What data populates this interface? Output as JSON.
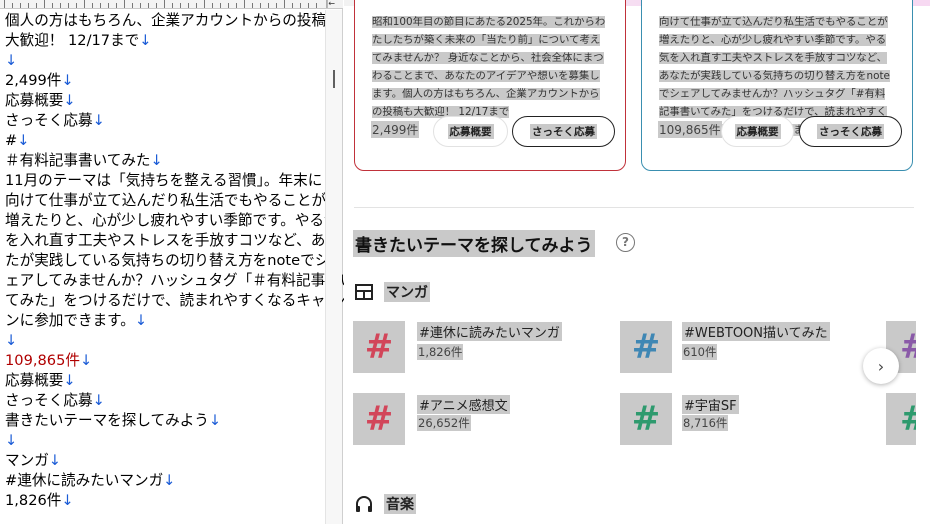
{
  "editor": {
    "ruler_end": "|←",
    "lines": [
      {
        "text": "個人の方はもちろん、企業アカウントからの投稿も",
        "cr": ""
      },
      {
        "text": "大歓迎！ 12/17まで",
        "cr": "↓"
      },
      {
        "text": "",
        "cr": "↓"
      },
      {
        "text": "2,499件",
        "cr": "↓"
      },
      {
        "text": "応募概要",
        "cr": "↓"
      },
      {
        "text": "さっそく応募",
        "cr": "↓"
      },
      {
        "text": "#",
        "cr": "↓"
      },
      {
        "text": "＃有料記事書いてみた",
        "cr": "↓"
      },
      {
        "text": "11月のテーマは「気持ちを整える習慣」。年末に",
        "cr": ""
      },
      {
        "text": "向けて仕事が立て込んだり私生活でもやることが",
        "cr": ""
      },
      {
        "text": "増えたりと、心が少し疲れやすい季節です。やる気",
        "cr": ""
      },
      {
        "text": "を入れ直す工夫やストレスを手放すコツなど、あな",
        "cr": ""
      },
      {
        "text": "たが実践している気持ちの切り替え方をnoteでシ",
        "cr": ""
      },
      {
        "text": "ェアしてみませんか？ハッシュタグ「＃有料記事書い",
        "cr": ""
      },
      {
        "text": "てみた」をつけるだけで、読まれやすくなるキャンペー",
        "cr": ""
      },
      {
        "text": "ンに参加できます。",
        "cr": "↓"
      },
      {
        "text": "",
        "cr": "↓"
      },
      {
        "text": "109,865件",
        "cr": "↓"
      },
      {
        "text": "応募概要",
        "cr": "↓"
      },
      {
        "text": "さっそく応募",
        "cr": "↓"
      },
      {
        "text": "書きたいテーマを探してみよう",
        "cr": "↓"
      },
      {
        "text": "",
        "cr": "↓"
      },
      {
        "text": "マンガ",
        "cr": "↓"
      },
      {
        "text": "#連休に読みたいマンガ",
        "cr": "↓"
      },
      {
        "text": "1,826件",
        "cr": "↓"
      }
    ]
  },
  "contests": [
    {
      "lines": [
        "昭和100年目の節目にあたる2025年。これからわ",
        "たしたちが築く未来の「当たり前」について考え",
        "てみませんか？ 身近なことから、社会全体にまつ",
        "わることまで、あなたのアイデアや想いを募集し",
        "ます。個人の方はもちろん、企業アカウントから",
        "の投稿も大歓迎！ 12/17まで"
      ],
      "count": "2,499件",
      "outline_label": "応募概要",
      "solid_label": "さっそく応募",
      "border_color": "#c0313a"
    },
    {
      "lines": [
        "向けて仕事が立て込んだり私生活でもやることが",
        "増えたりと、心が少し疲れやすい季節です。やる",
        "気を入れ直す工夫やストレスを手放すコツなど、",
        "あなたが実践している気持ちの切り替え方をnote",
        "でシェアしてみませんか？ハッシュタグ「#有料",
        "記事書いてみた」をつけるだけで、読まれやすく",
        "なるキャンペーンに参加できます。"
      ],
      "count": "109,865件",
      "outline_label": "応募概要",
      "solid_label": "さっそく応募",
      "border_color": "#3a8fb0"
    }
  ],
  "section_title": "書きたいテーマを探してみよう",
  "help_icon": "?",
  "categories": {
    "manga": {
      "label": "マンガ",
      "icon": "layout-icon"
    },
    "music": {
      "label": "音楽",
      "icon": "headphones-icon"
    }
  },
  "manga_tags": [
    {
      "name": "#連休に読みたいマンガ",
      "count": "1,826件",
      "color": "#d2465a"
    },
    {
      "name": "#WEBTOON描いてみた",
      "count": "610件",
      "color": "#3f87b4"
    },
    {
      "name": "#アニメ感想文",
      "count": "26,652件",
      "color": "#d2465a"
    },
    {
      "name": "#宇宙SF",
      "count": "8,716件",
      "color": "#2e9a6e"
    }
  ],
  "tile_glyph": "#",
  "next_icon": "›"
}
